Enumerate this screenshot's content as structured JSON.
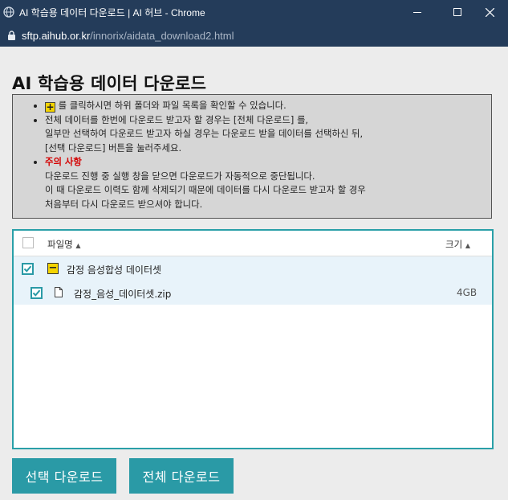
{
  "window": {
    "title": "AI 학습용 데이터 다운로드 | AI 허브 - Chrome",
    "url_host": "sftp.aihub.or.kr",
    "url_path": "/innorix/aidata_download2.html"
  },
  "page": {
    "heading": "AI 학습용 데이터 다운로드"
  },
  "info": {
    "line1_plus": "+",
    "line1": "를 클릭하시면 하위 폴더와 파일 목록을 확인할 수 있습니다.",
    "line2a": "전체 데이터를 한번에 다운로드 받고자 할 경우는 [전체 다운로드] 를,",
    "line2b": "일부만 선택하여 다운로드 받고자 하실 경우는 다운로드 받을 데이터를 선택하신 뒤,",
    "line2c": "[선택 다운로드] 버튼을 눌러주세요.",
    "warn_title": "주의 사항",
    "warn1": "다운로드 진행 중 실행 창을 닫으면 다운로드가 자동적으로 중단됩니다.",
    "warn2": "이 때 다운로드 이력도 함께 삭제되기 때문에 데이터를 다시 다운로드 받고자 할 경우",
    "warn3": "처음부터 다시 다운로드 받으셔야 합니다."
  },
  "table": {
    "col_name": "파일명",
    "col_size": "크기",
    "sort_arrow": "▲",
    "folder": {
      "name": "감정 음성합성 데이터셋",
      "toggle": "−"
    },
    "file": {
      "name": "감정_음성_데이터셋.zip",
      "size": "4GB"
    }
  },
  "buttons": {
    "selected": "선택 다운로드",
    "all": "전체 다운로드"
  },
  "colors": {
    "accent": "#2a9aa6",
    "titlebar": "#243c5a",
    "folder_toggle": "#f4d400"
  },
  "icons": [
    "globe-icon",
    "minimize-icon",
    "maximize-icon",
    "close-icon",
    "lock-icon",
    "plus-icon",
    "minus-icon",
    "file-icon",
    "check-icon",
    "sort-up-icon"
  ]
}
